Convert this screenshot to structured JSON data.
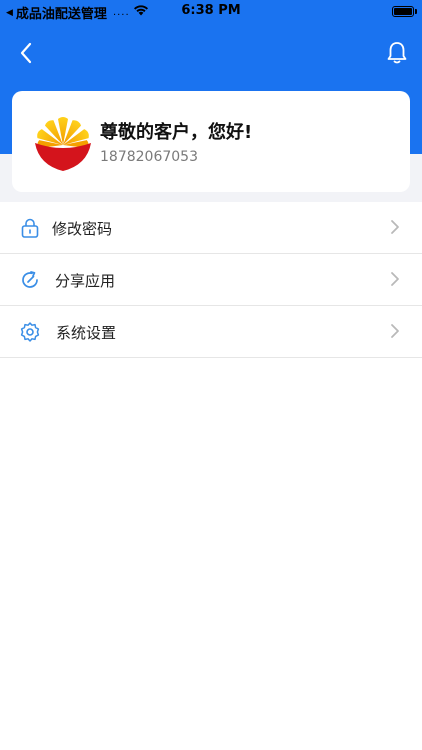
{
  "status_bar": {
    "back_app": "成品油配送管理",
    "signal": "....",
    "time": "6:38 PM"
  },
  "nav": {
    "back_icon": "chevron-left-icon",
    "bell_icon": "bell-icon"
  },
  "profile": {
    "greeting": "尊敬的客户，您好!",
    "phone": "18782067053",
    "logo": "petrochina-logo"
  },
  "menu": {
    "items": [
      {
        "label": "修改密码",
        "icon": "lock-icon"
      },
      {
        "label": "分享应用",
        "icon": "share-icon"
      },
      {
        "label": "系统设置",
        "icon": "gear-icon"
      }
    ]
  },
  "colors": {
    "header": "#1a73f0",
    "accent_icon": "#3a8ee6",
    "background": "#f2f3f7"
  }
}
